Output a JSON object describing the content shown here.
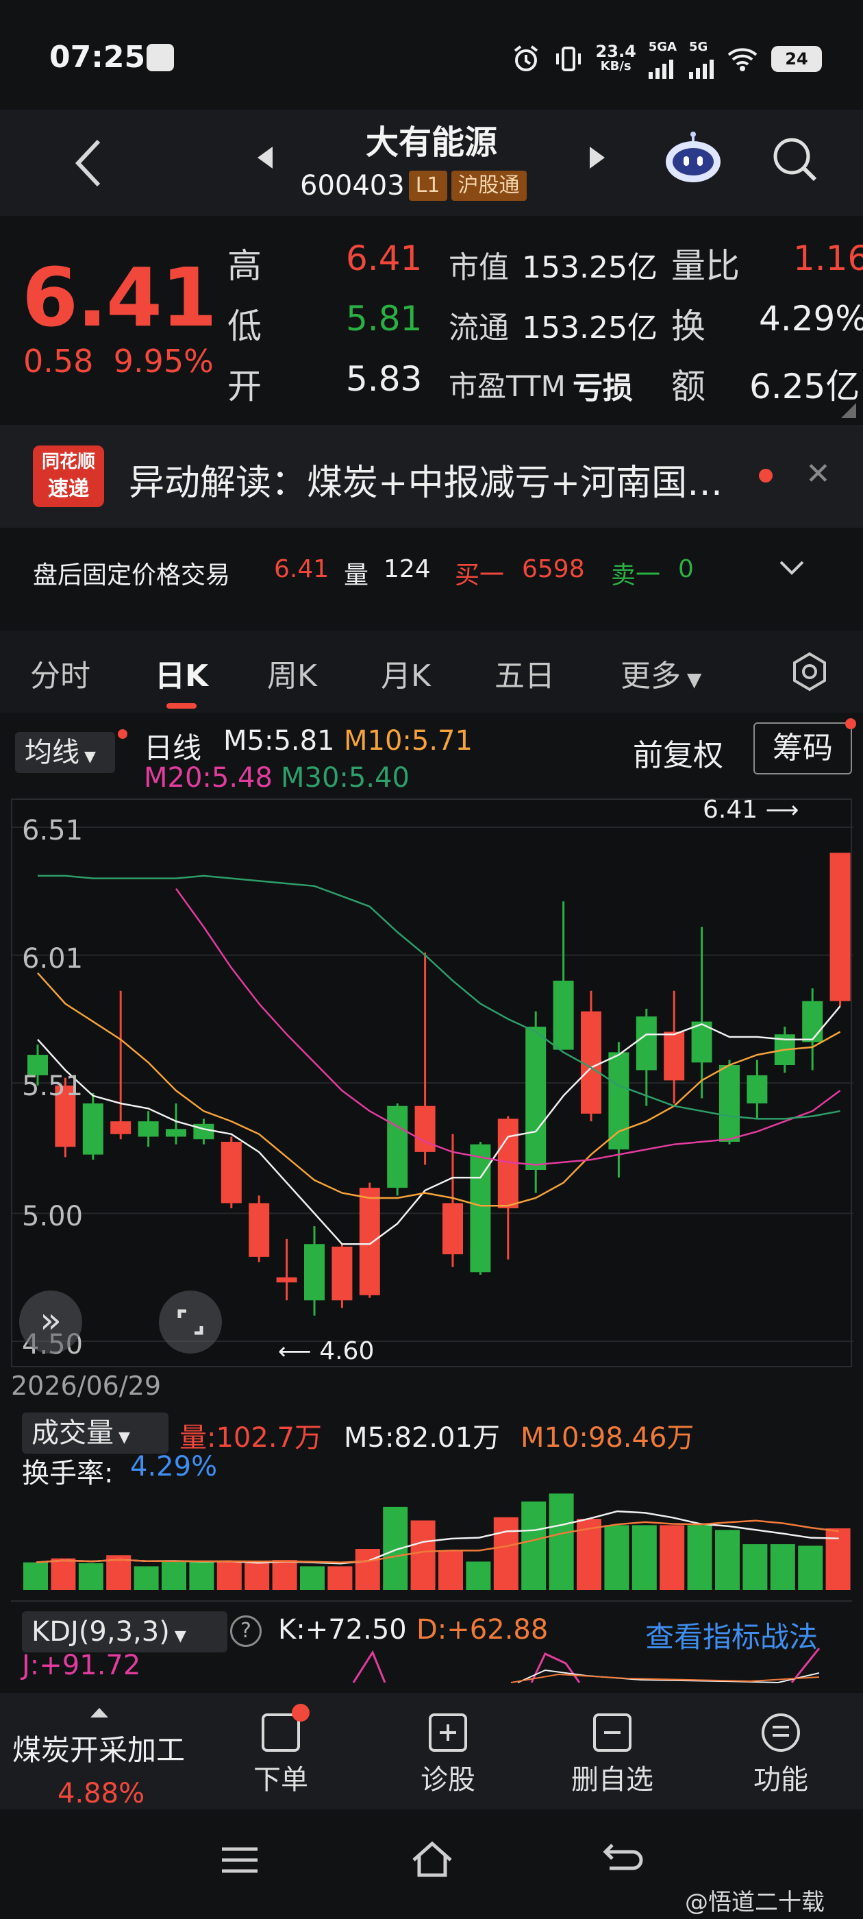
{
  "status_bar": {
    "time": "07:25",
    "net_speed": "23.4",
    "net_unit": "KB/s",
    "signal1": "5GA",
    "signal2": "5G",
    "battery": "24"
  },
  "header": {
    "stock_name": "大有能源",
    "stock_code": "600403",
    "tag_l1": "L1",
    "tag_market": "沪股通"
  },
  "quote": {
    "price": "6.41",
    "change": "0.58",
    "change_pct": "9.95%",
    "high_label": "高",
    "high": "6.41",
    "low_label": "低",
    "low": "5.81",
    "open_label": "开",
    "open": "5.83",
    "mktcap_label": "市值",
    "mktcap": "153.25亿",
    "float_label": "流通",
    "float": "153.25亿",
    "pe_label": "市盈TTM",
    "pe": "亏损",
    "vol_ratio_label": "量比",
    "vol_ratio": "1.16",
    "turnover_label": "换",
    "turnover": "4.29%",
    "amount_label": "额",
    "amount": "6.25亿"
  },
  "news": {
    "logo_line1": "同花顺",
    "logo_line2": "速递",
    "text": "异动解读：煤炭+中报减亏+河南国…"
  },
  "after_hours": {
    "label": "盘后固定价格交易",
    "price": "6.41",
    "vol_label": "量",
    "vol": "124",
    "bid_label": "买一",
    "bid": "6598",
    "ask_label": "卖一",
    "ask": "0"
  },
  "tabs": [
    "分时",
    "日K",
    "周K",
    "月K",
    "五日",
    "更多"
  ],
  "kline_header": {
    "ma_selector": "均线",
    "period": "日线",
    "m5": "M5:5.81",
    "m10": "M10:5.71",
    "m20": "M20:5.48",
    "m30": "M30:5.40",
    "adjust": "前复权",
    "chips": "筹码"
  },
  "chart_labels": {
    "high_mark": "6.41",
    "low_mark": "4.60",
    "date_left": "2026/06/29"
  },
  "volume": {
    "selector": "成交量",
    "vol": "量:102.7万",
    "m5": "M5:82.01万",
    "m10": "M10:98.46万",
    "turnover_label": "换手率:",
    "turnover": "4.29%"
  },
  "kdj": {
    "selector": "KDJ(9,3,3)",
    "k": "K:+72.50",
    "d": "D:+62.88",
    "j": "J:+91.72",
    "link": "查看指标战法"
  },
  "bottom_nav": {
    "sector": "煤炭开采加工",
    "sector_pct": "4.88%",
    "order": "下单",
    "diagnose": "诊股",
    "remove": "删自选",
    "func": "功能"
  },
  "watermark": "@悟道二十载",
  "chart_data": {
    "type": "candlestick",
    "y_ticks": [
      "6.51",
      "6.01",
      "5.51",
      "5.00",
      "4.50"
    ],
    "ylim": [
      4.5,
      6.51
    ],
    "candles": [
      {
        "o": 5.62,
        "c": 5.54,
        "h": 5.66,
        "l": 5.5
      },
      {
        "o": 5.26,
        "c": 5.5,
        "h": 5.53,
        "l": 5.22
      },
      {
        "o": 5.43,
        "c": 5.23,
        "h": 5.47,
        "l": 5.21
      },
      {
        "o": 5.31,
        "c": 5.36,
        "h": 5.87,
        "l": 5.29
      },
      {
        "o": 5.36,
        "c": 5.3,
        "h": 5.4,
        "l": 5.26
      },
      {
        "o": 5.33,
        "c": 5.3,
        "h": 5.43,
        "l": 5.27
      },
      {
        "o": 5.35,
        "c": 5.29,
        "h": 5.37,
        "l": 5.27
      },
      {
        "o": 5.04,
        "c": 5.28,
        "h": 5.3,
        "l": 5.02
      },
      {
        "o": 4.83,
        "c": 5.04,
        "h": 5.07,
        "l": 4.81
      },
      {
        "o": 4.73,
        "c": 4.75,
        "h": 4.9,
        "l": 4.66
      },
      {
        "o": 4.88,
        "c": 4.66,
        "h": 4.95,
        "l": 4.6
      },
      {
        "o": 4.66,
        "c": 4.87,
        "h": 4.88,
        "l": 4.63
      },
      {
        "o": 4.68,
        "c": 5.1,
        "h": 5.12,
        "l": 4.67
      },
      {
        "o": 5.42,
        "c": 5.1,
        "h": 5.43,
        "l": 5.07
      },
      {
        "o": 5.24,
        "c": 5.42,
        "h": 6.02,
        "l": 5.19
      },
      {
        "o": 4.84,
        "c": 5.04,
        "h": 5.31,
        "l": 4.79
      },
      {
        "o": 5.27,
        "c": 4.77,
        "h": 5.28,
        "l": 4.76
      },
      {
        "o": 5.02,
        "c": 5.37,
        "h": 5.38,
        "l": 4.82
      },
      {
        "o": 5.73,
        "c": 5.17,
        "h": 5.79,
        "l": 5.08
      },
      {
        "o": 5.91,
        "c": 5.64,
        "h": 6.22,
        "l": 5.64
      },
      {
        "o": 5.39,
        "c": 5.79,
        "h": 5.87,
        "l": 5.36
      },
      {
        "o": 5.63,
        "c": 5.25,
        "h": 5.67,
        "l": 5.14
      },
      {
        "o": 5.77,
        "c": 5.56,
        "h": 5.8,
        "l": 5.42
      },
      {
        "o": 5.52,
        "c": 5.71,
        "h": 5.87,
        "l": 5.43
      },
      {
        "o": 5.75,
        "c": 5.59,
        "h": 6.12,
        "l": 5.45
      },
      {
        "o": 5.58,
        "c": 5.28,
        "h": 5.6,
        "l": 5.27
      },
      {
        "o": 5.54,
        "c": 5.43,
        "h": 5.6,
        "l": 5.37
      },
      {
        "o": 5.7,
        "c": 5.58,
        "h": 5.73,
        "l": 5.55
      },
      {
        "o": 5.83,
        "c": 5.67,
        "h": 5.88,
        "l": 5.56
      },
      {
        "o": 5.83,
        "c": 6.41,
        "h": 6.41,
        "l": 5.81
      }
    ],
    "ma": {
      "M5": [
        5.68,
        5.56,
        5.46,
        5.43,
        5.41,
        5.36,
        5.33,
        5.31,
        5.24,
        5.12,
        5.0,
        4.88,
        4.88,
        4.96,
        5.09,
        5.14,
        5.14,
        5.3,
        5.32,
        5.46,
        5.57,
        5.62,
        5.7,
        5.7,
        5.74,
        5.69,
        5.69,
        5.68,
        5.68,
        5.81
      ],
      "M10": [
        5.94,
        5.82,
        5.75,
        5.68,
        5.59,
        5.48,
        5.4,
        5.36,
        5.31,
        5.22,
        5.13,
        5.08,
        5.06,
        5.06,
        5.08,
        5.06,
        5.03,
        5.03,
        5.06,
        5.12,
        5.23,
        5.32,
        5.36,
        5.42,
        5.52,
        5.58,
        5.62,
        5.64,
        5.65,
        5.71
      ],
      "M20": [
        null,
        null,
        null,
        null,
        null,
        6.27,
        6.12,
        5.96,
        5.82,
        5.7,
        5.59,
        5.48,
        5.4,
        5.34,
        5.28,
        5.24,
        5.22,
        5.2,
        5.19,
        5.2,
        5.21,
        5.23,
        5.25,
        5.27,
        5.28,
        5.29,
        5.32,
        5.36,
        5.4,
        5.48
      ],
      "M30": [
        6.32,
        6.32,
        6.31,
        6.31,
        6.31,
        6.31,
        6.32,
        6.31,
        6.3,
        6.29,
        6.28,
        6.24,
        6.2,
        6.1,
        6.01,
        5.91,
        5.82,
        5.76,
        5.71,
        5.63,
        5.57,
        5.5,
        5.46,
        5.42,
        5.4,
        5.38,
        5.37,
        5.37,
        5.38,
        5.4
      ]
    },
    "volume": [
      0.35,
      0.4,
      0.34,
      0.44,
      0.3,
      0.36,
      0.36,
      0.36,
      0.34,
      0.38,
      0.3,
      0.3,
      0.52,
      1.05,
      0.88,
      0.5,
      0.36,
      0.92,
      1.12,
      1.22,
      0.9,
      0.82,
      0.82,
      0.82,
      0.82,
      0.76,
      0.58,
      0.58,
      0.56,
      0.78
    ]
  }
}
